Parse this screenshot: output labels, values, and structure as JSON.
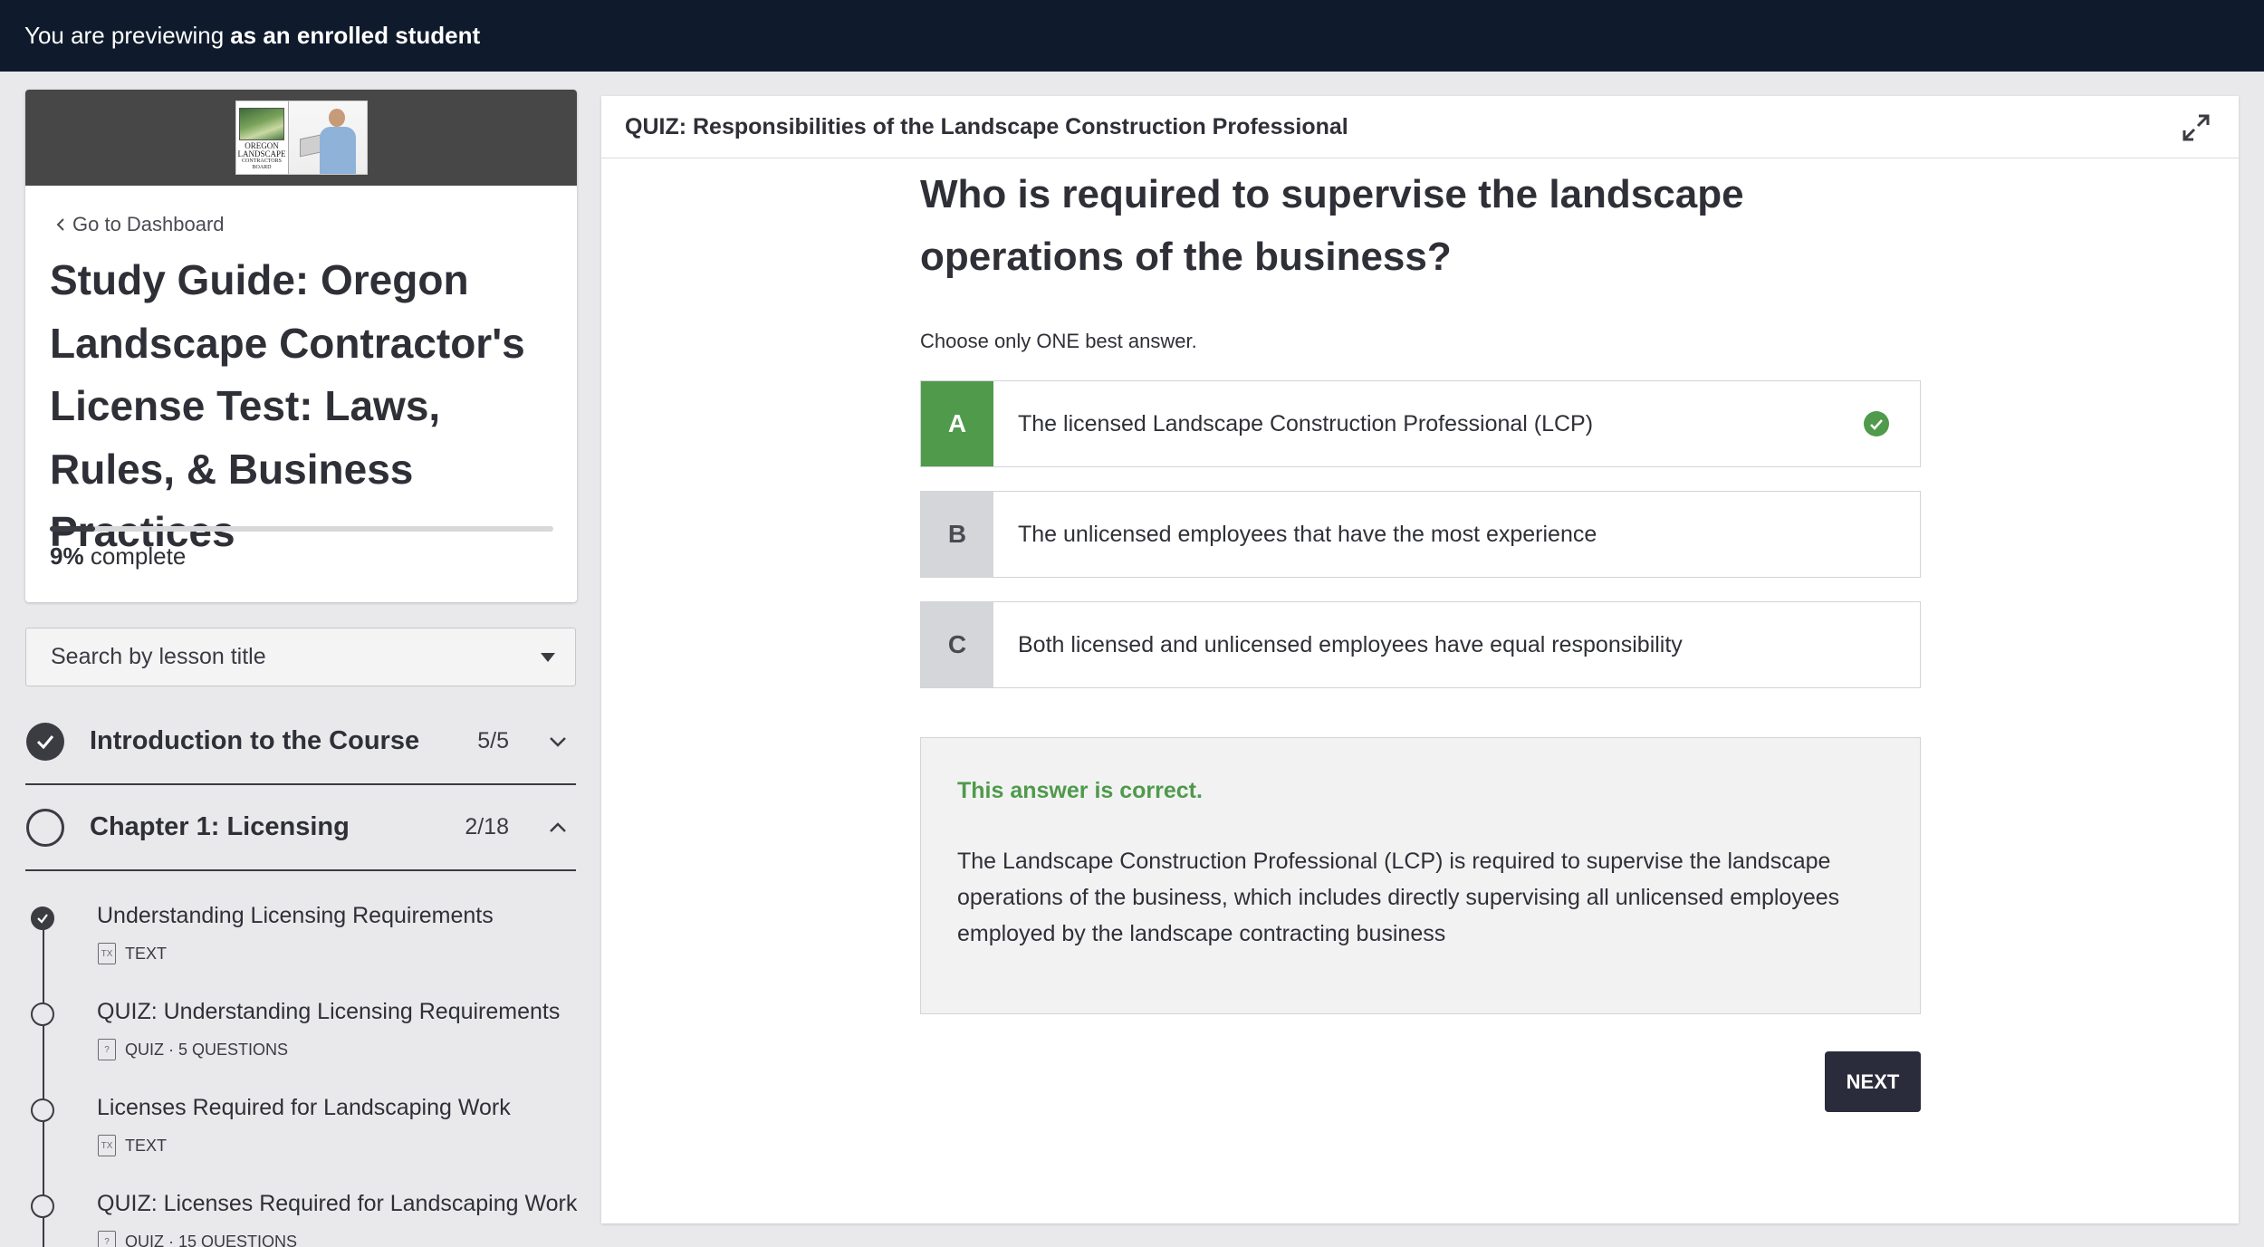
{
  "topbar": {
    "prefix": "You are previewing",
    "emphasis": "as an enrolled student"
  },
  "sidebar": {
    "logo_text": [
      "OREGON",
      "LANDSCAPE",
      "CONTRACTORS",
      "BOARD"
    ],
    "back_link": "Go to Dashboard",
    "course_title": "Study Guide: Oregon Landscape Contractor's License Test: Laws, Rules, & Business Practices",
    "progress_percent": 9,
    "progress_value": "9%",
    "progress_label": "complete",
    "search_placeholder": "Search by lesson title",
    "chapters": [
      {
        "title": "Introduction to the Course",
        "count": "5/5",
        "state": "complete",
        "expanded": false
      },
      {
        "title": "Chapter 1: Licensing",
        "count": "2/18",
        "state": "incomplete",
        "expanded": true
      }
    ],
    "lessons": [
      {
        "title": "Understanding Licensing Requirements",
        "meta": "TEXT",
        "done": true
      },
      {
        "title": "QUIZ: Understanding Licensing Requirements",
        "meta": "QUIZ · 5 QUESTIONS",
        "done": false
      },
      {
        "title": "Licenses Required for Landscaping Work",
        "meta": "TEXT",
        "done": false
      },
      {
        "title": "QUIZ: Licenses Required for Landscaping Work",
        "meta": "QUIZ · 15 QUESTIONS",
        "done": false
      }
    ]
  },
  "main": {
    "header_title": "QUIZ: Responsibilities of the Landscape Construction Professional",
    "question": "Who is required to supervise the landscape operations of the business?",
    "instruction": "Choose only ONE best answer.",
    "options": [
      {
        "letter": "A",
        "text": "The licensed Landscape Construction Professional (LCP)",
        "correct": true
      },
      {
        "letter": "B",
        "text": "The unlicensed employees that have the most experience",
        "correct": false
      },
      {
        "letter": "C",
        "text": "Both licensed and unlicensed employees have equal responsibility",
        "correct": false
      }
    ],
    "feedback_title": "This answer is correct.",
    "feedback_body": "The Landscape Construction Professional (LCP) is required to supervise the landscape operations of the business, which includes directly supervising all unlicensed employees employed by the landscape contracting business",
    "next_label": "NEXT"
  },
  "colors": {
    "topbar": "#0f1b2c",
    "correct_green": "#4f9a4b",
    "button_dark": "#2b2c3b"
  }
}
